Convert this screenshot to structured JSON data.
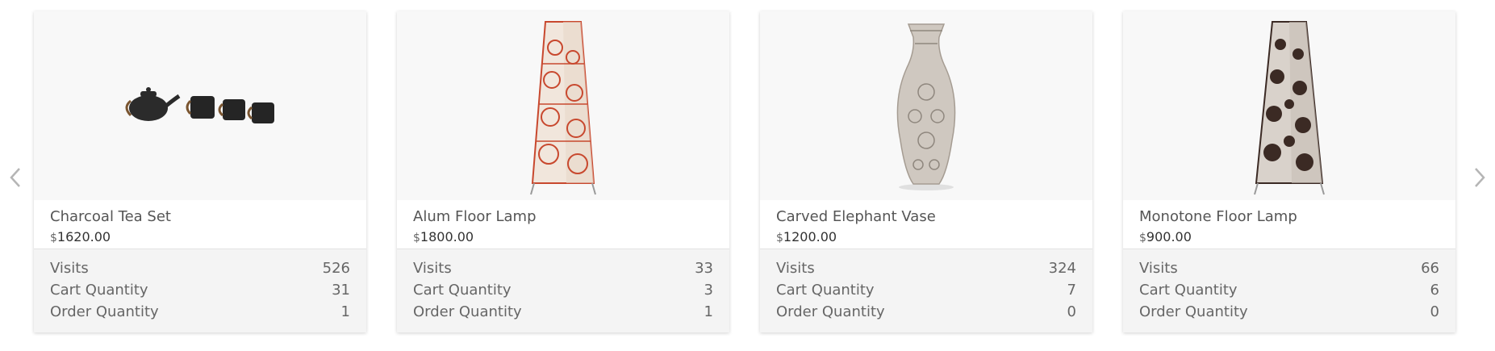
{
  "nav": {
    "prev_icon": "chevron-left-icon",
    "next_icon": "chevron-right-icon",
    "arrow_color": "#b5b5b5"
  },
  "currency_symbol": "$",
  "stat_labels": {
    "visits": "Visits",
    "cart": "Cart Quantity",
    "order": "Order Quantity"
  },
  "products": [
    {
      "name": "Charcoal Tea Set",
      "price": "1620.00",
      "visits": "526",
      "cart": "31",
      "order": "1",
      "image": "charcoal-tea-set-image"
    },
    {
      "name": "Alum Floor Lamp",
      "price": "1800.00",
      "visits": "33",
      "cart": "3",
      "order": "1",
      "image": "alum-floor-lamp-image"
    },
    {
      "name": "Carved Elephant Vase",
      "price": "1200.00",
      "visits": "324",
      "cart": "7",
      "order": "0",
      "image": "carved-elephant-vase-image"
    },
    {
      "name": "Monotone Floor Lamp",
      "price": "900.00",
      "visits": "66",
      "cart": "6",
      "order": "0",
      "image": "monotone-floor-lamp-image"
    }
  ]
}
